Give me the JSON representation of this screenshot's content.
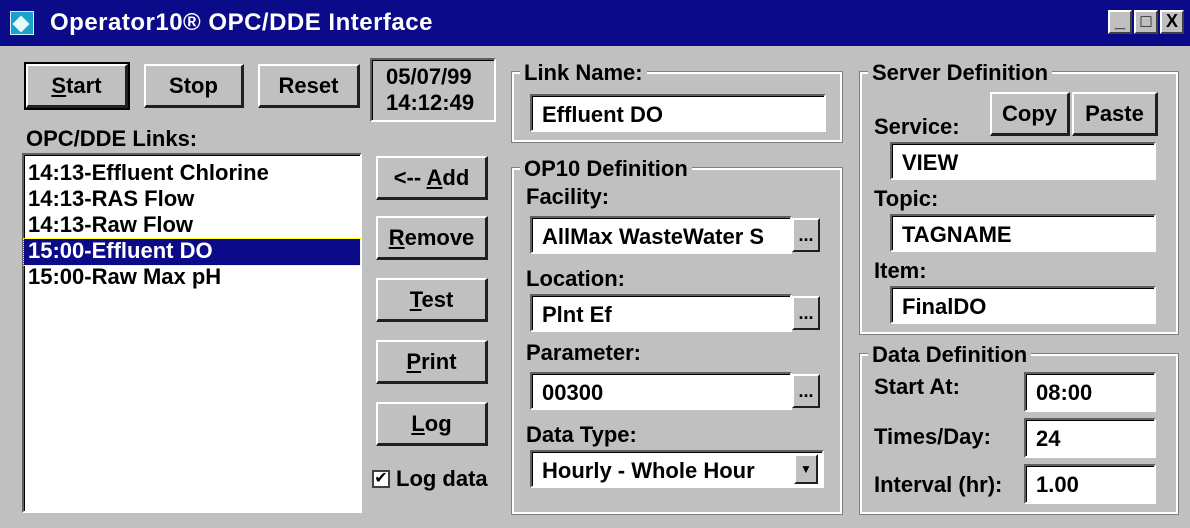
{
  "window": {
    "title": "Operator10® OPC/DDE Interface",
    "icons": {
      "app": "app-icon",
      "minimize": "minimize-icon",
      "maximize": "maximize-icon",
      "close": "close-icon"
    },
    "min_glyph": "_",
    "max_glyph": "□",
    "close_glyph": "X"
  },
  "toolbar": {
    "start_prefix": "",
    "start_ul": "S",
    "start_rest": "tart",
    "stop": "Stop",
    "reset": "Reset"
  },
  "clock": {
    "date": "05/07/99",
    "time": "14:12:49"
  },
  "links": {
    "label": "OPC/DDE Links:",
    "items": [
      "14:13-Effluent Chlorine",
      "14:13-RAS Flow",
      "14:13-Raw Flow",
      "15:00-Effluent DO",
      "15:00-Raw Max pH"
    ],
    "selected_index": 3
  },
  "actions": {
    "add_prefix": "<-- ",
    "add_ul": "A",
    "add_rest": "dd",
    "remove_ul": "R",
    "remove_rest": "emove",
    "test_ul": "T",
    "test_rest": "est",
    "print_ul": "P",
    "print_rest": "rint",
    "log_ul": "L",
    "log_rest": "og",
    "log_data_label": "Log data",
    "log_data_checked": "✔"
  },
  "link_name": {
    "title": "Link Name:",
    "value": "Effluent DO"
  },
  "op10": {
    "title": "OP10 Definition",
    "facility_label": "Facility:",
    "facility_value": "AllMax WasteWater S",
    "location_label": "Location:",
    "location_value": "Plnt Ef",
    "parameter_label": "Parameter:",
    "parameter_value": "00300",
    "ellipsis": "...",
    "datatype_label": "Data Type:",
    "datatype_value": "Hourly - Whole Hour",
    "dropdown_glyph": "▼"
  },
  "server": {
    "title": "Server Definition",
    "service_label": "Service:",
    "service_value": "VIEW",
    "copy": "Copy",
    "paste": "Paste",
    "topic_label": "Topic:",
    "topic_value": "TAGNAME",
    "item_label": "Item:",
    "item_value": "FinalDO"
  },
  "data_def": {
    "title": "Data Definition",
    "start_label": "Start At:",
    "start_value": "08:00",
    "times_label": "Times/Day:",
    "times_value": "24",
    "interval_label": "Interval (hr):",
    "interval_value": "1.00"
  }
}
